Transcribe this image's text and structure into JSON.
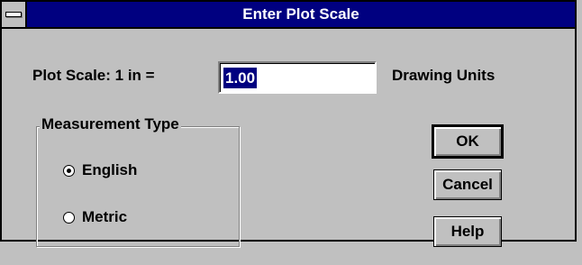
{
  "window": {
    "title": "Enter Plot Scale",
    "sysmenu_icon": "system-menu-icon"
  },
  "scale": {
    "label_prefix": "Plot Scale: 1 in =",
    "value": "1.00",
    "label_suffix": "Drawing Units"
  },
  "measurement": {
    "group_title": "Measurement Type",
    "options": [
      {
        "label": "English",
        "selected": true
      },
      {
        "label": "Metric",
        "selected": false
      }
    ]
  },
  "buttons": {
    "ok": "OK",
    "cancel": "Cancel",
    "help": "Help"
  },
  "colors": {
    "titlebar": "#000080",
    "face": "#c0c0c0",
    "selection": "#000080"
  }
}
